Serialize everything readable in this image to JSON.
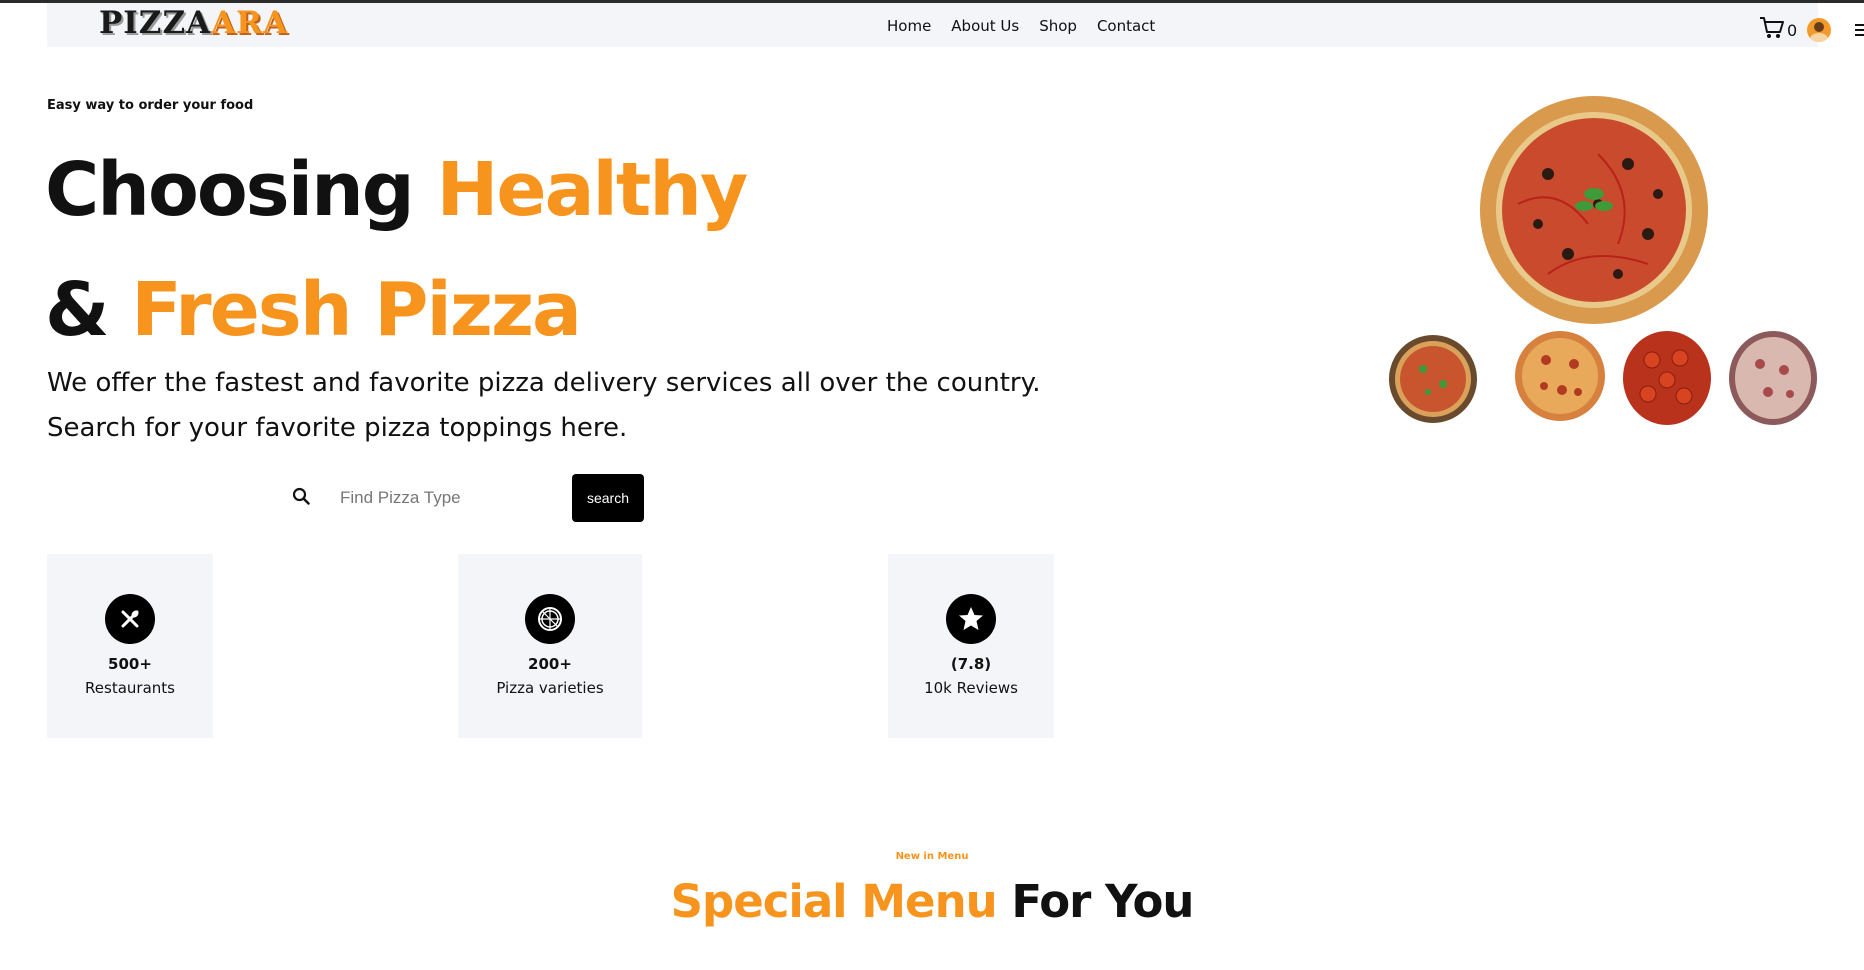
{
  "nav": {
    "logo_part1": "PIZZA",
    "logo_part2": "ARA",
    "links": [
      "Home",
      "About Us",
      "Shop",
      "Contact"
    ],
    "cart_count": "0"
  },
  "hero": {
    "tagline": "Easy way to order your food",
    "title_line1_a": "Choosing ",
    "title_line1_b": "Healthy",
    "title_line2_a": "& ",
    "title_line2_b": "Fresh Pizza",
    "desc_line1": "We offer the fastest and favorite pizza delivery services all over the country.",
    "desc_line2": "Search for your favorite pizza toppings here."
  },
  "search": {
    "placeholder": "Find Pizza Type",
    "button_label": "search"
  },
  "stats": [
    {
      "icon": "utensils-icon",
      "number": "500+",
      "label": "Restaurants"
    },
    {
      "icon": "pizza-icon",
      "number": "200+",
      "label": "Pizza varieties"
    },
    {
      "icon": "star-icon",
      "number": "(7.8)",
      "label": "10k Reviews"
    }
  ],
  "menu_section": {
    "kicker": "New in Menu",
    "title_a": "Special Menu",
    "title_b": " For You"
  },
  "colors": {
    "accent": "#f7941d",
    "nav_bg": "#f3f5f9",
    "button_bg": "#000000"
  }
}
